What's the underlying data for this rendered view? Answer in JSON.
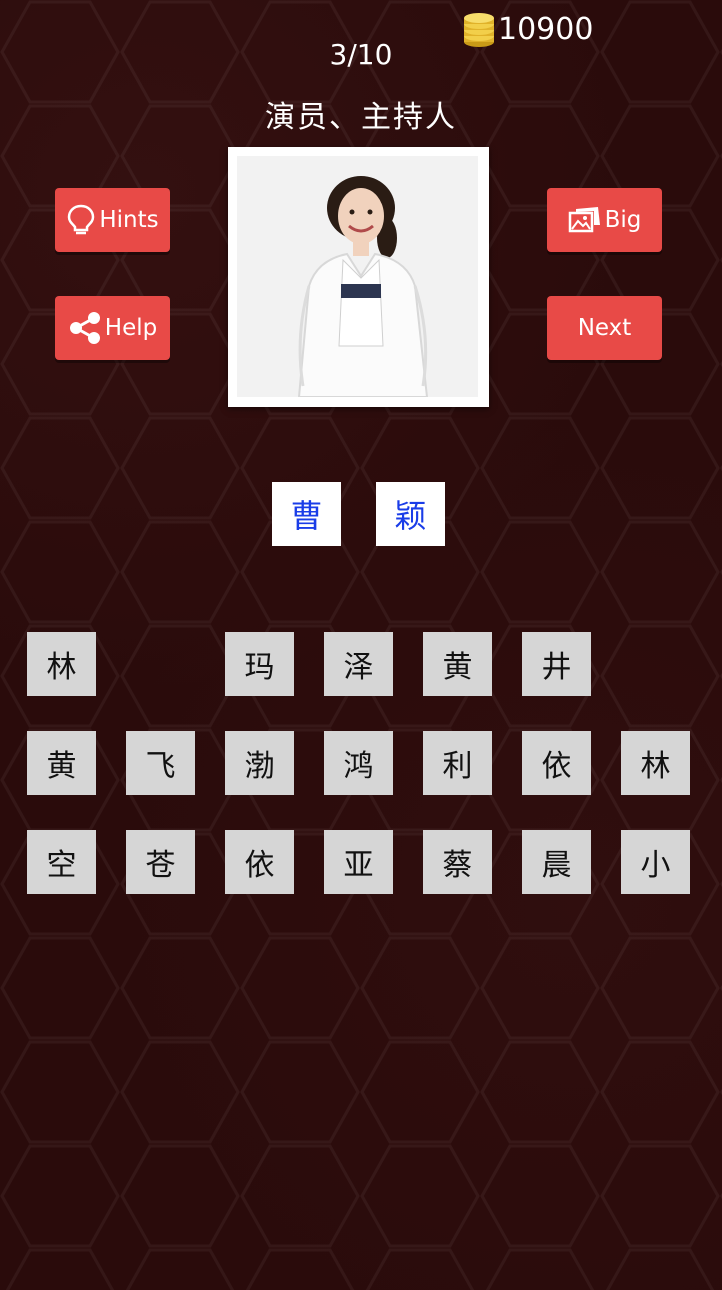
{
  "header": {
    "coins": "10900",
    "level": "3/10",
    "category": "演员、主持人"
  },
  "icons": {
    "coin": "coin-stack-icon",
    "hints": "lightbulb-icon",
    "help": "share-icon",
    "big": "picture-icon"
  },
  "buttons": {
    "hints": "Hints",
    "help": "Help",
    "big": "Big",
    "next": "Next"
  },
  "answer": [
    "曹",
    "颖"
  ],
  "letters": {
    "row1": [
      "林",
      "",
      "玛",
      "泽",
      "黄",
      "井",
      ""
    ],
    "row2": [
      "黄",
      "飞",
      "渤",
      "鸿",
      "利",
      "依",
      "林"
    ],
    "row3": [
      "空",
      "苍",
      "依",
      "亚",
      "蔡",
      "晨",
      "小"
    ]
  },
  "colors": {
    "accent": "#e84a47",
    "background": "#2a0b0b",
    "answer_text": "#1a3de8",
    "tile": "#d6d6d6"
  }
}
